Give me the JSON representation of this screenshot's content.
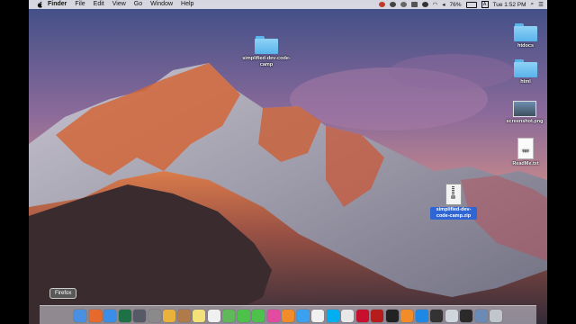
{
  "menubar": {
    "app_name": "Finder",
    "menus": [
      "File",
      "Edit",
      "View",
      "Go",
      "Window",
      "Help"
    ],
    "battery": "76%",
    "clock": "Tue 1:52 PM"
  },
  "desktop_items": [
    {
      "label": "simplified-dev-code-camp",
      "kind": "folder"
    },
    {
      "label": "htdocs",
      "kind": "folder"
    },
    {
      "label": "html",
      "kind": "folder"
    },
    {
      "label": "screenshot.png",
      "kind": "image"
    },
    {
      "label": "ReadMe.txt",
      "kind": "text"
    },
    {
      "label": "simplified-dev-code-camp.zip",
      "kind": "zip"
    }
  ],
  "dock": {
    "tooltip": "Firefox",
    "icons": [
      "finder-icon",
      "firefox-icon",
      "safari-icon",
      "excel-icon",
      "launchpad-icon",
      "system-preferences-icon",
      "photos-icon",
      "contacts-icon",
      "notes-icon",
      "reminders-icon",
      "maps-icon",
      "messages-icon",
      "facetime-icon",
      "itunes-icon",
      "ibooks-icon",
      "app-store-icon",
      "chrome-icon",
      "skype-icon",
      "textedit-icon",
      "acrobat-icon",
      "filezilla-icon",
      "terminal-icon",
      "sublime-icon",
      "vscode-icon",
      "activity-monitor-icon",
      "preview-icon",
      "quicktime-icon",
      "downloads-icon",
      "trash-icon"
    ],
    "colors": [
      "#4a90e2",
      "#e66a2c",
      "#3b8ee8",
      "#1e7145",
      "#555a66",
      "#8a8a8a",
      "#e8b23c",
      "#b07a4a",
      "#f3e27a",
      "#f0f0f0",
      "#5fb85a",
      "#4cc24a",
      "#4cc24a",
      "#e34ba0",
      "#f28c28",
      "#3aa0f0",
      "#f0f0f0",
      "#00aff0",
      "#e8e8e8",
      "#c8102e",
      "#b71c1c",
      "#222222",
      "#f28c28",
      "#1e88e5",
      "#333333",
      "#d0d6de",
      "#2a2a2a",
      "#6b8bb5",
      "#c0c6cc"
    ]
  }
}
